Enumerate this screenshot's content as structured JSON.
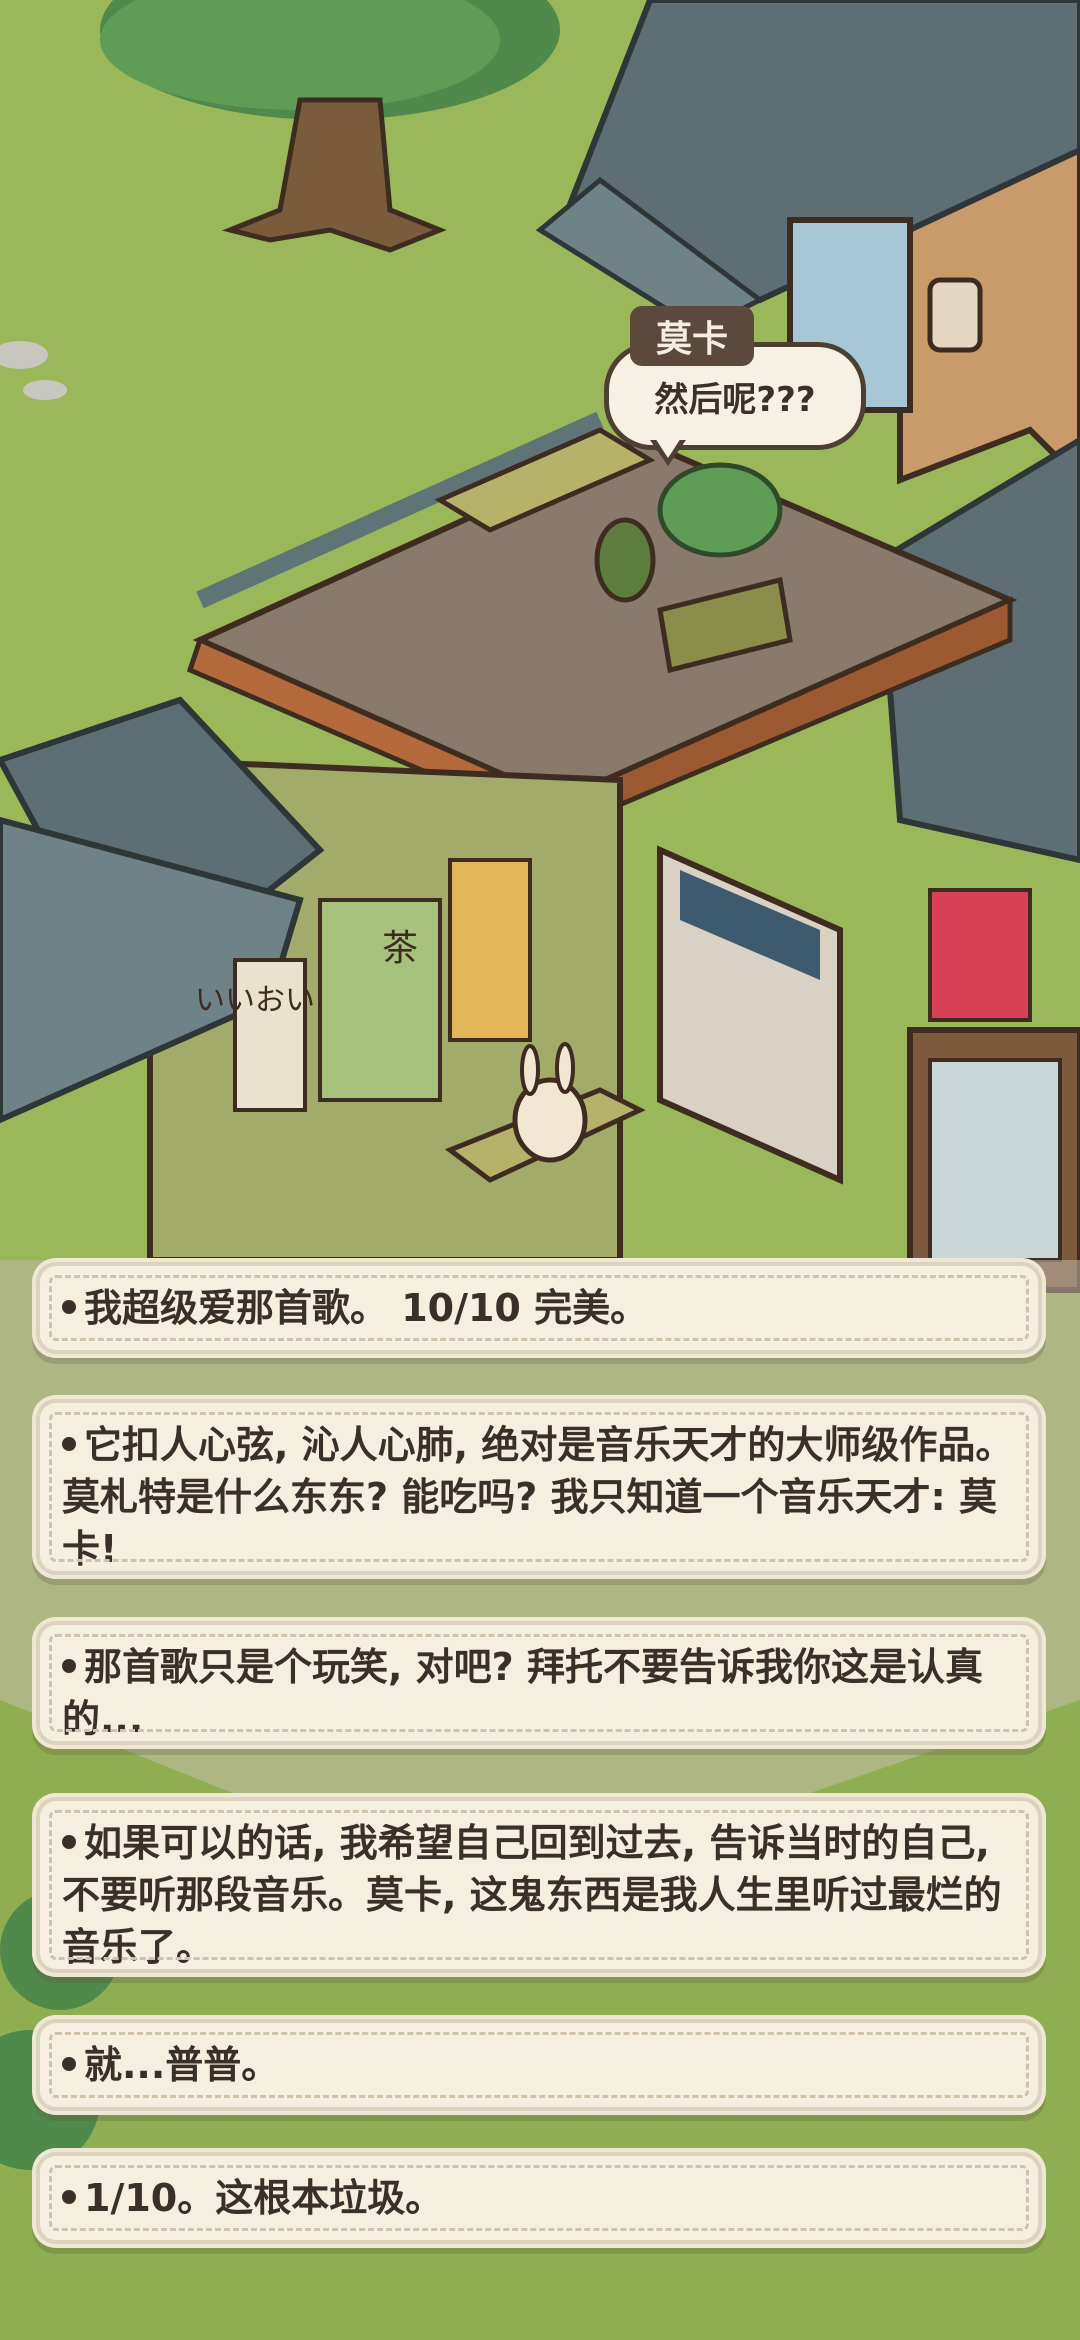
{
  "dialog": {
    "speaker": "莫卡",
    "line": "然后呢???"
  },
  "choices": [
    "我超级爱那首歌。 10/10 完美。",
    "它扣人心弦, 沁人心肺, 绝对是音乐天才的大师级作品。莫札特是什么东东? 能吃吗? 我只知道一个音乐天才: 莫卡!",
    "那首歌只是个玩笑, 对吧? 拜托不要告诉我你这是认真的...",
    "如果可以的话, 我希望自己回到过去, 告诉当时的自己, 不要听那段音乐。莫卡, 这鬼东西是我人生里听过最烂的音乐了。",
    "就...普普。",
    "1/10。这根本垃圾。"
  ],
  "colors": {
    "grass": "#9ab85a",
    "panel": "#f4efdf",
    "text": "#3a3029",
    "speaker_tag": "#5b4a3c"
  },
  "poster_texts": {
    "tea": "茶",
    "oishii": "いいおいし"
  }
}
